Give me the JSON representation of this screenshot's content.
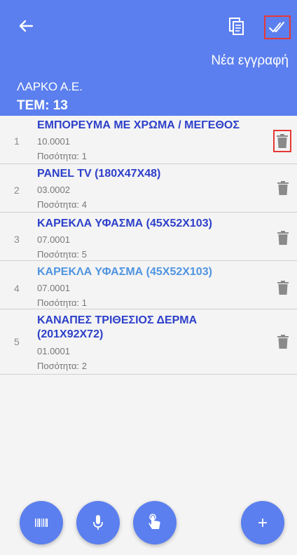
{
  "header": {
    "new_entry_label": "Νέα εγγραφή",
    "company": "ΛΑΡΚΟ Α.Ε.",
    "count_label": "ΤΕΜ: 13"
  },
  "items": [
    {
      "num": "1",
      "title": "ΕΜΠΟΡΕΥΜΑ ΜΕ ΧΡΩΜΑ / ΜΕΓΕΘΟΣ",
      "code": "10.0001",
      "qty": "Ποσότητα: 1"
    },
    {
      "num": "2",
      "title": "PANEL TV (180X47X48)",
      "code": "03.0002",
      "qty": "Ποσότητα: 4"
    },
    {
      "num": "3",
      "title": "ΚΑΡΕΚΛΑ ΥΦΑΣΜΑ (45X52X103)",
      "code": "07.0001",
      "qty": "Ποσότητα: 5"
    },
    {
      "num": "4",
      "title": "ΚΑΡΕΚΛΑ ΥΦΑΣΜΑ (45X52X103)",
      "code": "07.0001",
      "qty": "Ποσότητα: 1"
    },
    {
      "num": "5",
      "title_line1": "ΚΑΝΑΠΕΣ ΤΡΙΘΕΣΙΟΣ ΔΕΡΜΑ",
      "title_line2": "(201X92X72)",
      "code": "01.0001",
      "qty": "Ποσότητα: 2"
    }
  ],
  "colors": {
    "primary": "#5b7fee",
    "title": "#2d40c9",
    "title_selected": "#4f94e0",
    "highlight": "#e53935"
  },
  "icons": [
    "back-arrow-icon",
    "copy-icon",
    "double-check-icon",
    "trash-icon",
    "barcode-icon",
    "microphone-icon",
    "touch-icon",
    "plus-icon"
  ]
}
